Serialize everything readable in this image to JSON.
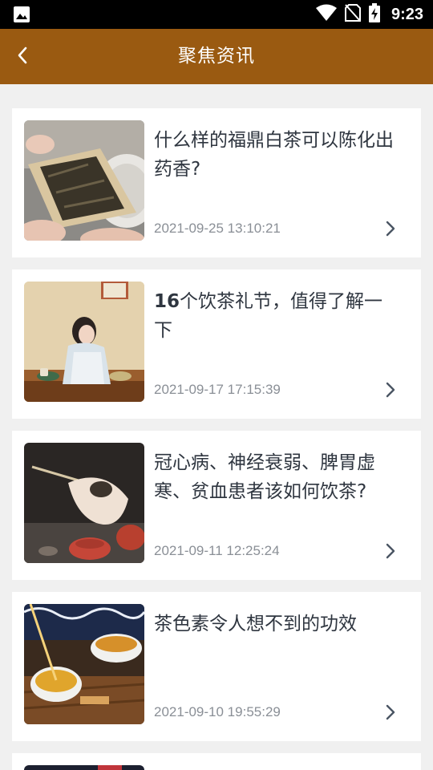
{
  "status_bar": {
    "time": "9:23",
    "icons": [
      "image-notification-icon",
      "wifi-icon",
      "no-sim-icon",
      "battery-charging-icon"
    ]
  },
  "app_bar": {
    "title": "聚焦资讯",
    "back_icon": "chevron-left-icon"
  },
  "articles": [
    {
      "title": "什么样的福鼎白茶可以陈化出药香?",
      "date": "2021-09-25 13:10:21",
      "thumb": "tea-leaves-tray-image"
    },
    {
      "title_num": "16",
      "title": "个饮茶礼节，值得了解一下",
      "date": "2021-09-17 17:15:39",
      "thumb": "woman-tea-ceremony-image"
    },
    {
      "title": "冠心病、神经衰弱、脾胃虚寒、贫血患者该如何饮茶?",
      "date": "2021-09-11 12:25:24",
      "thumb": "tea-pot-hand-image"
    },
    {
      "title": "茶色素令人想不到的功效",
      "date": "2021-09-10 19:55:29",
      "thumb": "pouring-tea-cups-image"
    }
  ],
  "colors": {
    "app_bar": "#9a5a11",
    "background": "#f0f0f0",
    "title_text": "#2f3640",
    "date_text": "#8a8f96"
  }
}
